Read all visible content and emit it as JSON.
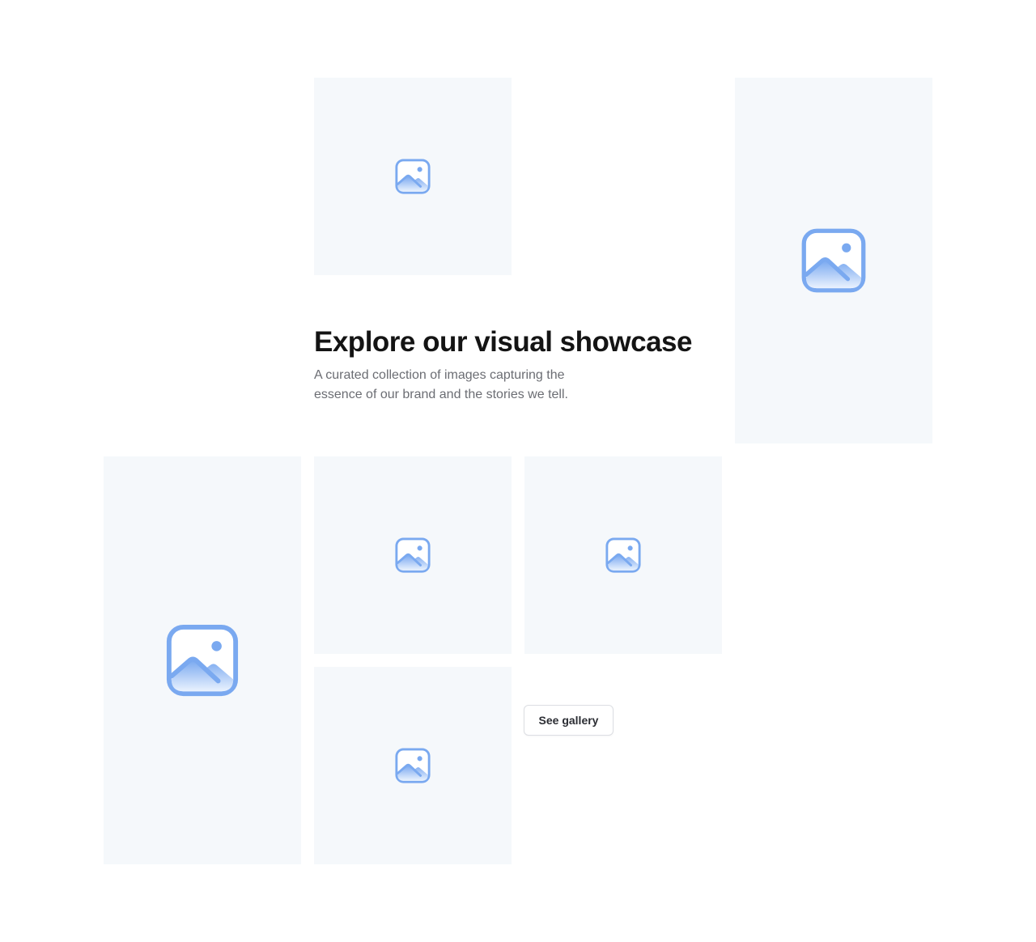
{
  "hero": {
    "title": "Explore our visual showcase",
    "subtitle": "A curated collection of images capturing the essence of our brand and the stories we tell."
  },
  "cta": {
    "label": "See gallery"
  },
  "gallery": {
    "tiles": [
      {
        "icon": "image-placeholder-icon"
      },
      {
        "icon": "image-placeholder-icon"
      },
      {
        "icon": "image-placeholder-icon"
      },
      {
        "icon": "image-placeholder-icon"
      },
      {
        "icon": "image-placeholder-icon"
      },
      {
        "icon": "image-placeholder-icon"
      }
    ]
  },
  "colors": {
    "tile_background": "#f5f8fb",
    "icon_stroke": "#7aa9f0",
    "icon_fill_top": "#7aa9f0",
    "icon_fill_bottom": "#e8f1fe",
    "heading": "#141414",
    "body_text": "#6b6d73"
  }
}
